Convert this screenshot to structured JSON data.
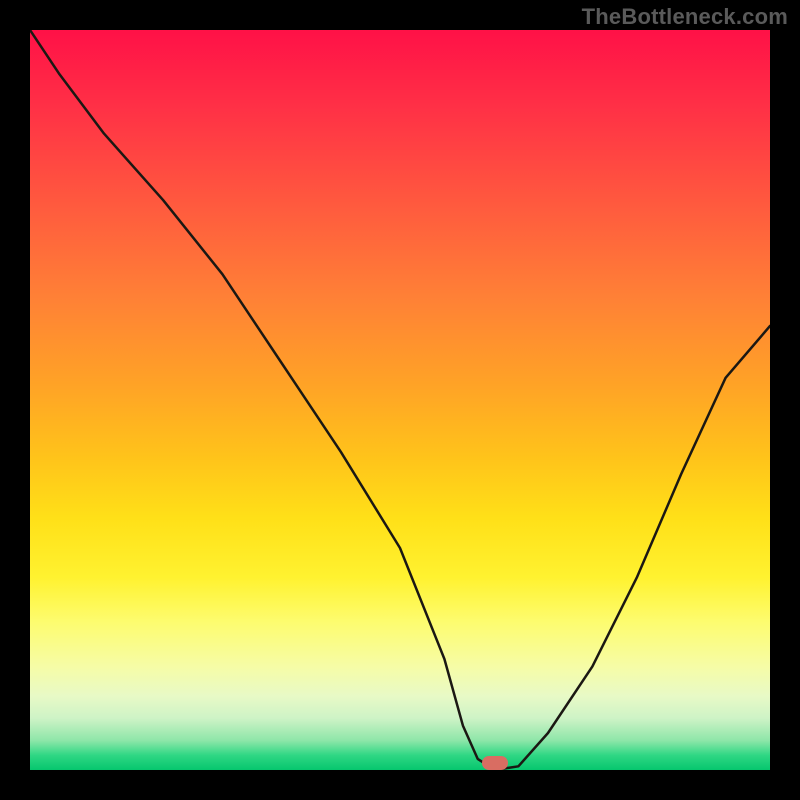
{
  "watermark": "TheBottleneck.com",
  "marker": {
    "x_pct": 62.8,
    "y_pct": 99.0
  },
  "colors": {
    "frame_bg": "#000000",
    "curve_stroke": "#1b1813",
    "marker_fill": "#d96d62",
    "watermark_text": "#5a5a5a"
  },
  "chart_data": {
    "type": "line",
    "title": "",
    "xlabel": "",
    "ylabel": "",
    "xlim": [
      0,
      100
    ],
    "ylim": [
      0,
      100
    ],
    "grid": false,
    "note": "Axes are normalized 0–100 (% of plot area, origin bottom-left). No tick labels are shown in the image, so values are relative coordinates, not real units.",
    "series": [
      {
        "name": "bottleneck-curve",
        "x": [
          0,
          4,
          10,
          18,
          26,
          34,
          42,
          50,
          56,
          58.5,
          60.5,
          62.8,
          66,
          70,
          76,
          82,
          88,
          94,
          100
        ],
        "y": [
          100,
          94,
          86,
          77,
          67,
          55,
          43,
          30,
          15,
          6,
          1.5,
          0,
          0.5,
          5,
          14,
          26,
          40,
          53,
          60
        ]
      }
    ],
    "marker_point": {
      "x": 62.8,
      "y": 0
    }
  }
}
